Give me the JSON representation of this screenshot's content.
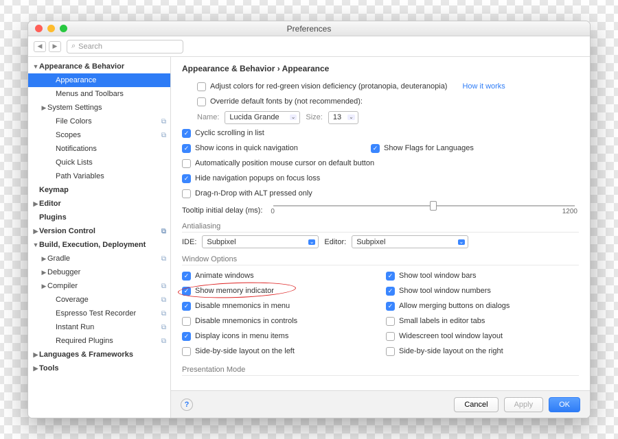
{
  "window": {
    "title": "Preferences"
  },
  "search": {
    "placeholder": "Search"
  },
  "breadcrumb": "Appearance & Behavior › Appearance",
  "sidebar": [
    {
      "label": "Appearance & Behavior",
      "level": 0,
      "expanded": true,
      "arrow": "▼"
    },
    {
      "label": "Appearance",
      "level": 1,
      "selected": true
    },
    {
      "label": "Menus and Toolbars",
      "level": 1
    },
    {
      "label": "System Settings",
      "level": 1,
      "arrow": "▶",
      "hasArrow": true
    },
    {
      "label": "File Colors",
      "level": 1,
      "badge": "⧉"
    },
    {
      "label": "Scopes",
      "level": 1,
      "badge": "⧉"
    },
    {
      "label": "Notifications",
      "level": 1
    },
    {
      "label": "Quick Lists",
      "level": 1
    },
    {
      "label": "Path Variables",
      "level": 1
    },
    {
      "label": "Keymap",
      "level": 0
    },
    {
      "label": "Editor",
      "level": 0,
      "arrow": "▶"
    },
    {
      "label": "Plugins",
      "level": 0
    },
    {
      "label": "Version Control",
      "level": 0,
      "arrow": "▶",
      "badge": "⧉"
    },
    {
      "label": "Build, Execution, Deployment",
      "level": 0,
      "expanded": true,
      "arrow": "▼"
    },
    {
      "label": "Gradle",
      "level": 1,
      "arrow": "▶",
      "hasArrow": true,
      "badge": "⧉"
    },
    {
      "label": "Debugger",
      "level": 1,
      "arrow": "▶",
      "hasArrow": true
    },
    {
      "label": "Compiler",
      "level": 1,
      "arrow": "▶",
      "hasArrow": true,
      "badge": "⧉"
    },
    {
      "label": "Coverage",
      "level": 1,
      "badge": "⧉"
    },
    {
      "label": "Espresso Test Recorder",
      "level": 1,
      "badge": "⧉"
    },
    {
      "label": "Instant Run",
      "level": 1,
      "badge": "⧉"
    },
    {
      "label": "Required Plugins",
      "level": 1,
      "badge": "⧉"
    },
    {
      "label": "Languages & Frameworks",
      "level": 0,
      "arrow": "▶"
    },
    {
      "label": "Tools",
      "level": 0,
      "arrow": "▶"
    }
  ],
  "opts": {
    "adjustColors": "Adjust colors for red-green vision deficiency (protanopia, deuteranopia)",
    "howItWorks": "How it works",
    "overrideFonts": "Override default fonts by (not recommended):",
    "nameLabel": "Name:",
    "fontName": "Lucida Grande",
    "sizeLabel": "Size:",
    "fontSize": "13",
    "cyclic": "Cyclic scrolling in list",
    "showIcons": "Show icons in quick navigation",
    "showFlags": "Show Flags for Languages",
    "autoPos": "Automatically position mouse cursor on default button",
    "hideNav": "Hide navigation popups on focus loss",
    "dnd": "Drag-n-Drop with ALT pressed only",
    "tooltipLabel": "Tooltip initial delay (ms):",
    "tooltipMin": "0",
    "tooltipMax": "1200"
  },
  "aa": {
    "section": "Antialiasing",
    "ideLabel": "IDE:",
    "ideValue": "Subpixel",
    "editorLabel": "Editor:",
    "editorValue": "Subpixel"
  },
  "win": {
    "section": "Window Options",
    "left": [
      {
        "label": "Animate windows",
        "checked": true
      },
      {
        "label": "Show memory indicator",
        "checked": true,
        "circled": true
      },
      {
        "label": "Disable mnemonics in menu",
        "checked": true
      },
      {
        "label": "Disable mnemonics in controls",
        "checked": false
      },
      {
        "label": "Display icons in menu items",
        "checked": true
      },
      {
        "label": "Side-by-side layout on the left",
        "checked": false
      }
    ],
    "right": [
      {
        "label": "Show tool window bars",
        "checked": true
      },
      {
        "label": "Show tool window numbers",
        "checked": true
      },
      {
        "label": "Allow merging buttons on dialogs",
        "checked": true
      },
      {
        "label": "Small labels in editor tabs",
        "checked": false
      },
      {
        "label": "Widescreen tool window layout",
        "checked": false
      },
      {
        "label": "Side-by-side layout on the right",
        "checked": false
      }
    ]
  },
  "presentation": "Presentation Mode",
  "footer": {
    "cancel": "Cancel",
    "apply": "Apply",
    "ok": "OK"
  }
}
